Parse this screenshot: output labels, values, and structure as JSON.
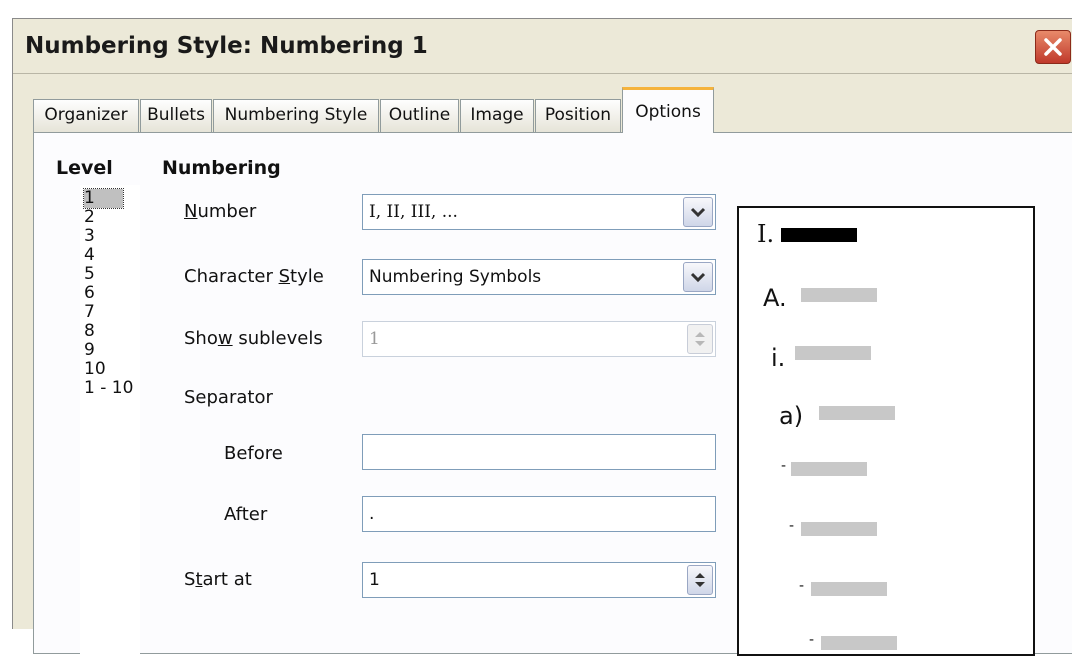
{
  "dialog": {
    "title": "Numbering Style: Numbering 1"
  },
  "tabs": [
    {
      "label": "Organizer"
    },
    {
      "label": "Bullets"
    },
    {
      "label": "Numbering Style"
    },
    {
      "label": "Outline"
    },
    {
      "label": "Image"
    },
    {
      "label": "Position"
    },
    {
      "label": "Options",
      "active": true
    }
  ],
  "level": {
    "header": "Level",
    "items": [
      "1",
      "2",
      "3",
      "4",
      "5",
      "6",
      "7",
      "8",
      "9",
      "10",
      "1 - 10"
    ],
    "selected": "1"
  },
  "numbering": {
    "header": "Numbering",
    "number": {
      "label_pre": "",
      "label_key": "N",
      "label_post": "umber",
      "value": "I, II, III, ..."
    },
    "character_style": {
      "label_pre": "Character ",
      "label_key": "S",
      "label_post": "tyle",
      "value": "Numbering Symbols"
    },
    "show_sublevels": {
      "label_pre": "Sho",
      "label_key": "w",
      "label_post": " sublevels",
      "value": "1"
    },
    "separator": {
      "label": "Separator"
    },
    "before": {
      "label": "Before",
      "value": ""
    },
    "after": {
      "label": "After",
      "value": "."
    },
    "start_at": {
      "label_pre": "S",
      "label_key": "t",
      "label_post": "art at",
      "value": "1"
    }
  },
  "preview": {
    "items": [
      "I.",
      "A.",
      "i.",
      "a)",
      "-",
      "-",
      "-",
      "-"
    ]
  },
  "colors": {
    "accent_tab": "#f5b33c",
    "close_button": "#c0392b",
    "preview_bar_active": "#000000",
    "preview_bar_inactive": "#c8c8c8"
  }
}
